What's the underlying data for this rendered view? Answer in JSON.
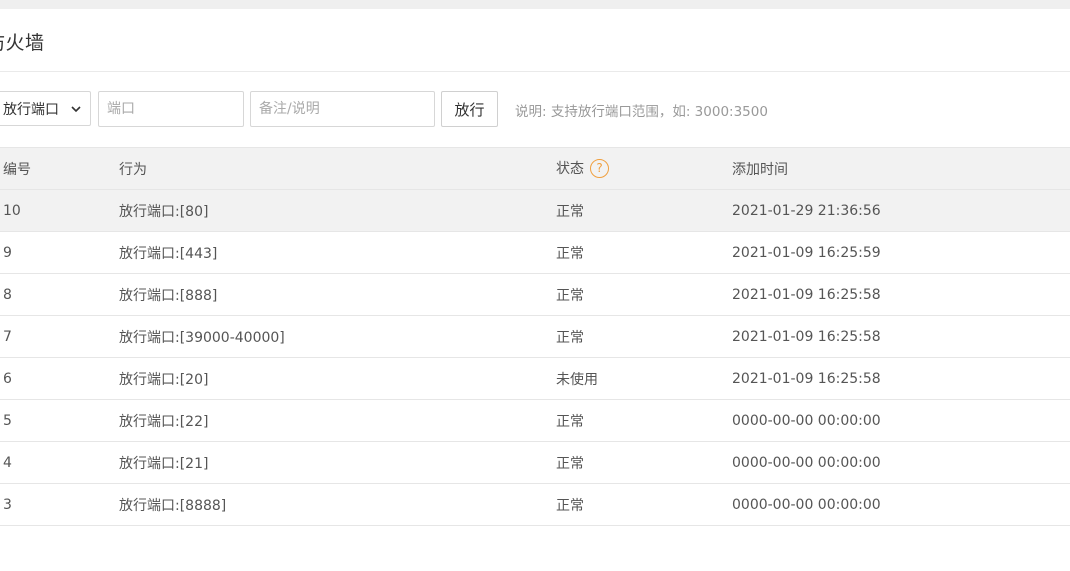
{
  "page": {
    "title": "防火墙"
  },
  "toolbar": {
    "rule_type_selected": "放行端口",
    "port_placeholder": "端口",
    "note_placeholder": "备注/说明",
    "allow_button_label": "放行",
    "hint": "说明: 支持放行端口范围，如: 3000:3500"
  },
  "table": {
    "columns": [
      "编号",
      "行为",
      "状态",
      "添加时间"
    ],
    "help_icon_glyph": "?",
    "rows": [
      {
        "id": "10",
        "action": "放行端口:[80]",
        "status": "正常",
        "added": "2021-01-29 21:36:56"
      },
      {
        "id": "9",
        "action": "放行端口:[443]",
        "status": "正常",
        "added": "2021-01-09 16:25:59"
      },
      {
        "id": "8",
        "action": "放行端口:[888]",
        "status": "正常",
        "added": "2021-01-09 16:25:58"
      },
      {
        "id": "7",
        "action": "放行端口:[39000-40000]",
        "status": "正常",
        "added": "2021-01-09 16:25:58"
      },
      {
        "id": "6",
        "action": "放行端口:[20]",
        "status": "未使用",
        "added": "2021-01-09 16:25:58"
      },
      {
        "id": "5",
        "action": "放行端口:[22]",
        "status": "正常",
        "added": "0000-00-00 00:00:00"
      },
      {
        "id": "4",
        "action": "放行端口:[21]",
        "status": "正常",
        "added": "0000-00-00 00:00:00"
      },
      {
        "id": "3",
        "action": "放行端口:[8888]",
        "status": "正常",
        "added": "0000-00-00 00:00:00"
      }
    ]
  },
  "colors": {
    "help_icon": "#f0a040",
    "header_bg": "#f2f2f2",
    "border": "#e6e6e6"
  }
}
